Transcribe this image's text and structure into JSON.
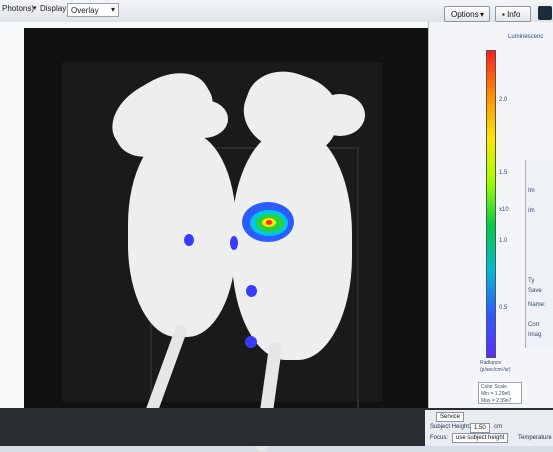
{
  "toolbar": {
    "photons_label": "Photons)",
    "display_label": "Display:",
    "display_value": "Overlay",
    "options_label": "Options",
    "info_label": "Info"
  },
  "legend": {
    "title": "Luminescenc",
    "ticks": [
      "2.0",
      "1.5",
      "1.0",
      "0.5"
    ],
    "exponent": "x10",
    "radiance_label": "Radiance",
    "radiance_units": "(p/sec/cm²/sr)",
    "color_scale_title": "Color Scale",
    "color_scale_min": "Min = 1.29e6",
    "color_scale_max": "Max = 2.39e7"
  },
  "side_panel": {
    "items": [
      "Im",
      "Im",
      "Ty",
      "Save",
      "Name:",
      "Corr",
      "Imag"
    ]
  },
  "bottom": {
    "service_button": "Service",
    "subject_height_label": "Subject Height:",
    "subject_height_value": "1.50",
    "subject_height_unit": "cm",
    "focus_label": "Focus:",
    "focus_value": "use subject height",
    "temperature_label": "Temperature"
  },
  "colors": {
    "signal_high": "#ff2a1a",
    "signal_mid": "#28d23c",
    "signal_low": "#2b5cff"
  }
}
